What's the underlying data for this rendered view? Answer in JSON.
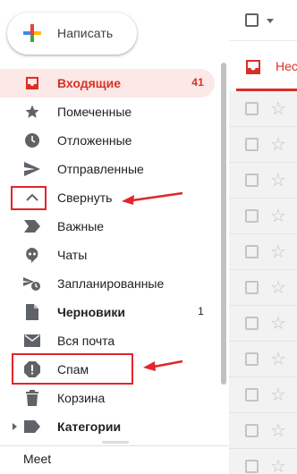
{
  "compose": {
    "label": "Написать"
  },
  "nav": {
    "items": [
      {
        "name": "inbox",
        "label": "Входящие",
        "count": "41",
        "icon": "inbox-icon"
      },
      {
        "name": "starred",
        "label": "Помеченные",
        "count": "",
        "icon": "star-icon"
      },
      {
        "name": "snoozed",
        "label": "Отложенные",
        "count": "",
        "icon": "clock-icon"
      },
      {
        "name": "sent",
        "label": "Отправленные",
        "count": "",
        "icon": "send-icon"
      },
      {
        "name": "collapse",
        "label": "Свернуть",
        "count": "",
        "icon": "chevron-up-icon"
      },
      {
        "name": "important",
        "label": "Важные",
        "count": "",
        "icon": "important-icon"
      },
      {
        "name": "chats",
        "label": "Чаты",
        "count": "",
        "icon": "chat-icon"
      },
      {
        "name": "scheduled",
        "label": "Запланированные",
        "count": "",
        "icon": "scheduled-icon"
      },
      {
        "name": "drafts",
        "label": "Черновики",
        "count": "1",
        "icon": "draft-icon"
      },
      {
        "name": "all-mail",
        "label": "Вся почта",
        "count": "",
        "icon": "mail-icon"
      },
      {
        "name": "spam",
        "label": "Спам",
        "count": "",
        "icon": "spam-icon"
      },
      {
        "name": "trash",
        "label": "Корзина",
        "count": "",
        "icon": "trash-icon"
      },
      {
        "name": "categories",
        "label": "Категории",
        "count": "",
        "icon": "label-icon"
      }
    ]
  },
  "meet": {
    "label": "Meet"
  },
  "tab": {
    "label": "Нес"
  },
  "colors": {
    "accent": "#d93025",
    "active_bg": "#fce8e6",
    "annotation": "#e3242b",
    "icon": "#5f6368"
  }
}
